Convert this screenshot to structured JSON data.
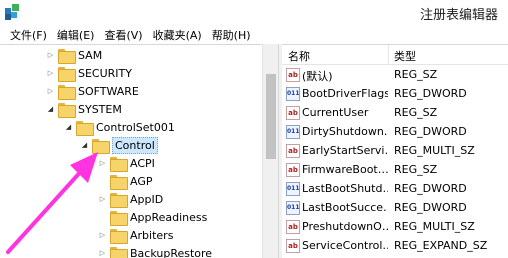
{
  "window": {
    "title": "注册表编辑器"
  },
  "menu": [
    "文件(F)",
    "编辑(E)",
    "查看(V)",
    "收藏夹(A)",
    "帮助(H)"
  ],
  "tree": [
    {
      "label": "SAM",
      "toggle": "▷"
    },
    {
      "label": "SECURITY",
      "toggle": "▷"
    },
    {
      "label": "SOFTWARE",
      "toggle": "▷"
    },
    {
      "label": "SYSTEM",
      "toggle": "◢"
    },
    {
      "label": "ControlSet001",
      "toggle": "◢"
    },
    {
      "label": "Control",
      "toggle": "◢"
    },
    {
      "label": "ACPI",
      "toggle": "▷"
    },
    {
      "label": "AGP",
      "toggle": ""
    },
    {
      "label": "AppID",
      "toggle": "▷"
    },
    {
      "label": "AppReadiness",
      "toggle": ""
    },
    {
      "label": "Arbiters",
      "toggle": "▷"
    },
    {
      "label": "BackupRestore",
      "toggle": "▷"
    }
  ],
  "list": {
    "headers": {
      "name": "名称",
      "type": "类型"
    },
    "rows": [
      {
        "name": "(默认)",
        "type": "REG_SZ",
        "icon": "string-value-icon",
        "badge": "ab"
      },
      {
        "name": "BootDriverFlags",
        "type": "REG_DWORD",
        "icon": "binary-value-icon",
        "badge": "011"
      },
      {
        "name": "CurrentUser",
        "type": "REG_SZ",
        "icon": "string-value-icon",
        "badge": "ab"
      },
      {
        "name": "DirtyShutdown…",
        "type": "REG_DWORD",
        "icon": "binary-value-icon",
        "badge": "011"
      },
      {
        "name": "EarlyStartServi…",
        "type": "REG_MULTI_SZ",
        "icon": "string-value-icon",
        "badge": "ab"
      },
      {
        "name": "FirmwareBoot…",
        "type": "REG_SZ",
        "icon": "string-value-icon",
        "badge": "ab"
      },
      {
        "name": "LastBootShutd…",
        "type": "REG_DWORD",
        "icon": "binary-value-icon",
        "badge": "011"
      },
      {
        "name": "LastBootSucce…",
        "type": "REG_DWORD",
        "icon": "binary-value-icon",
        "badge": "011"
      },
      {
        "name": "PreshutdownO…",
        "type": "REG_MULTI_SZ",
        "icon": "string-value-icon",
        "badge": "ab"
      },
      {
        "name": "ServiceControl…",
        "type": "REG_EXPAND_SZ",
        "icon": "string-value-icon",
        "badge": "ab"
      }
    ]
  },
  "colors": {
    "arrow": "#ff33e0",
    "folder": "#f6d469",
    "selection": "#cce8ff"
  }
}
